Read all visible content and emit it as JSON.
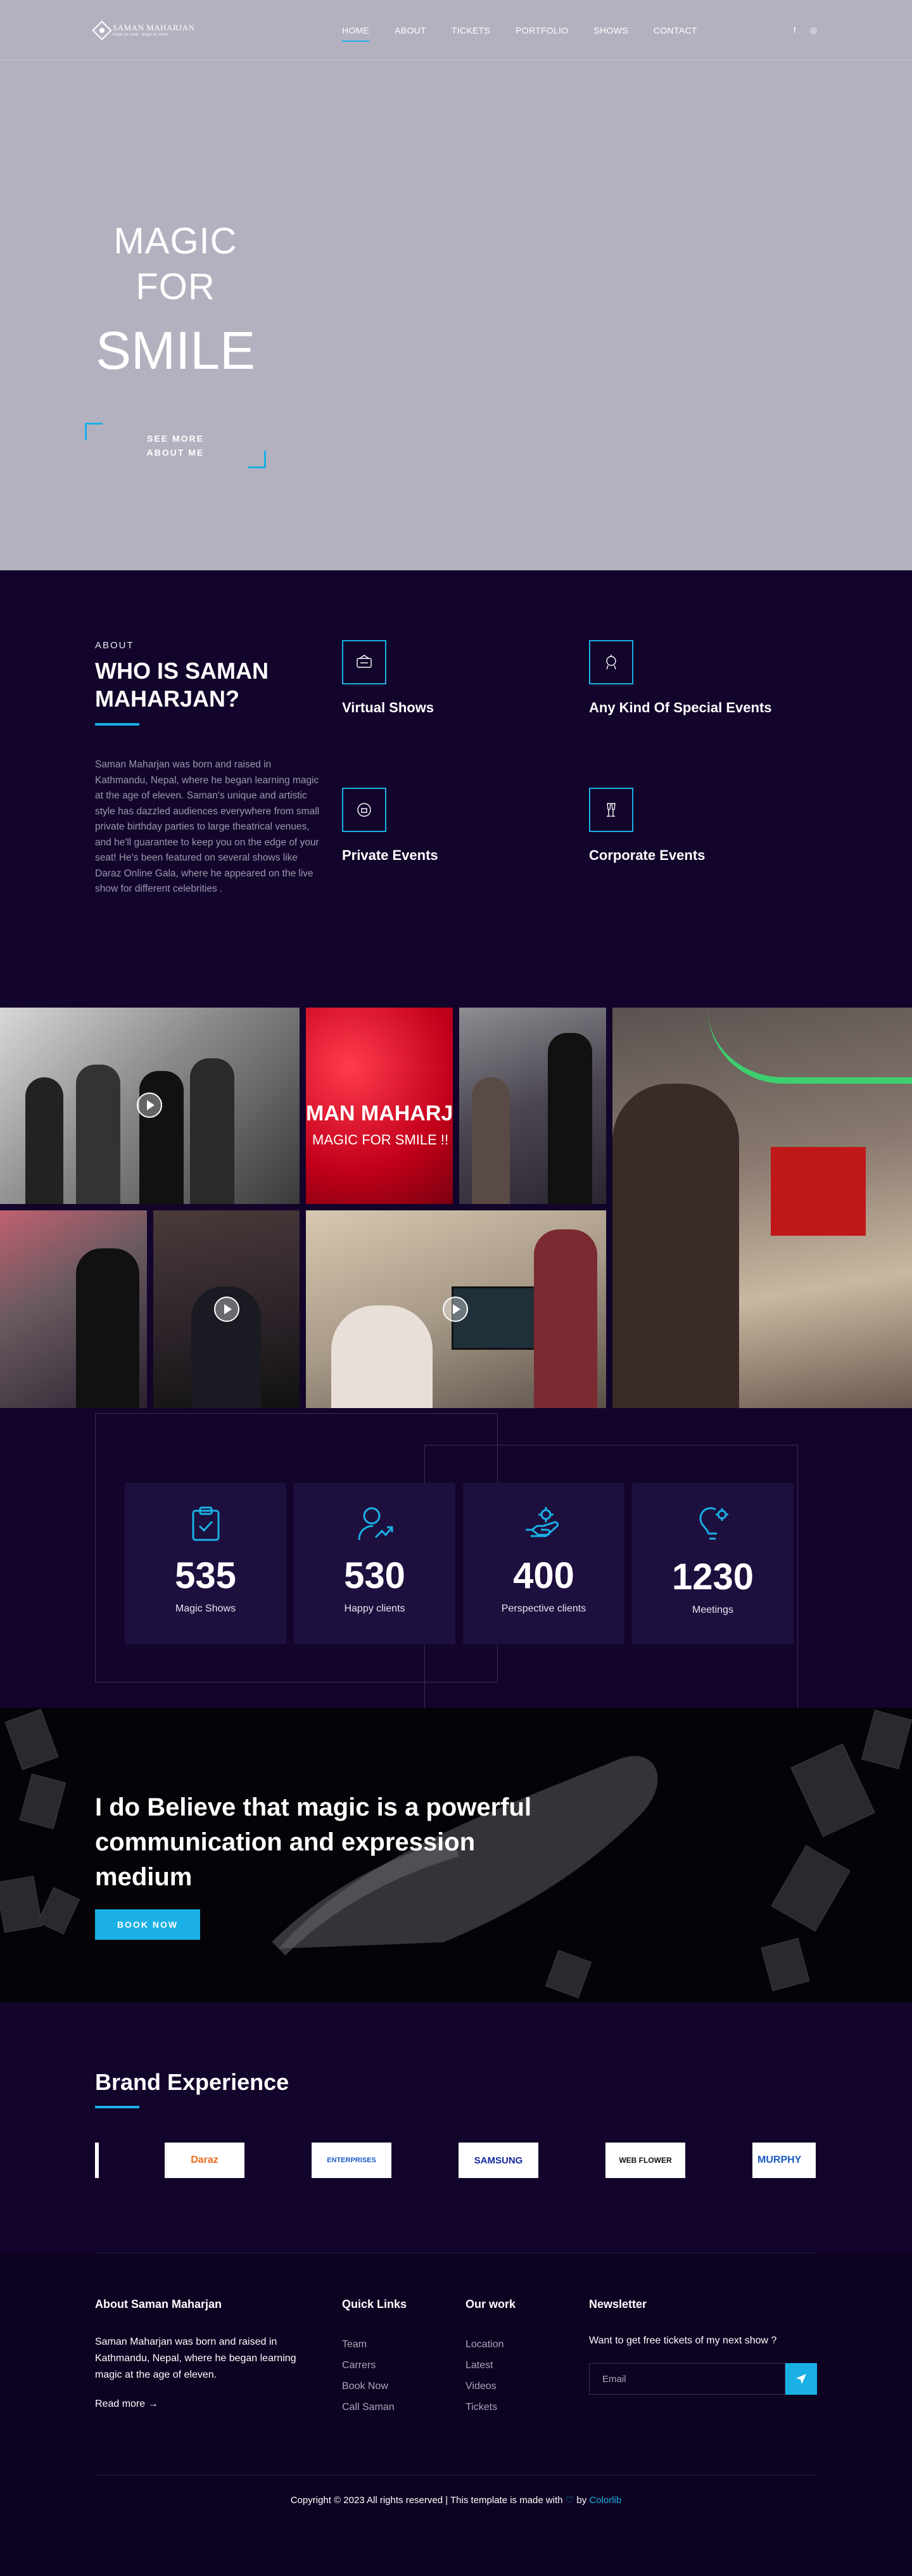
{
  "header": {
    "logo_name": "SAMAN MAHARJAN",
    "logo_tag": "Magic for smile · Magic for Smile",
    "nav": [
      "HOME",
      "ABOUT",
      "TICKETS",
      "PORTFOLIO",
      "SHOWS",
      "CONTACT"
    ],
    "social": [
      "f",
      "◎"
    ]
  },
  "hero": {
    "line1a": "MAGIC",
    "line1b": "FOR",
    "line2": "SMILE",
    "cta_line1": "SEE MORE",
    "cta_line2": "ABOUT ME"
  },
  "about": {
    "eyebrow": "ABOUT",
    "title": "WHO IS SAMAN MAHARJAN?",
    "text": "Saman Maharjan was born and raised in Kathmandu, Nepal, where he began learning magic at the age of eleven. Saman's unique and artistic style has dazzled audiences everywhere from small private birthday parties to large theatrical venues, and he'll guarantee to keep you on the edge of your seat! He's been featured on several shows like Daraz Online Gala, where he appeared on the live show for different celebrities .",
    "services": [
      {
        "title": "Virtual Shows",
        "icon": "virtual-show-icon"
      },
      {
        "title": "Any Kind Of Special Events",
        "icon": "special-event-icon"
      },
      {
        "title": "Private Events",
        "icon": "private-event-icon"
      },
      {
        "title": "Corporate Events",
        "icon": "corporate-event-icon"
      }
    ]
  },
  "gallery": {
    "red_text1": "MAN MAHARJ",
    "red_text2": "MAGIC FOR SMILE !!"
  },
  "stats": [
    {
      "value": "535",
      "label": "Magic Shows"
    },
    {
      "value": "530",
      "label": "Happy clients"
    },
    {
      "value": "400",
      "label": "Perspective clients"
    },
    {
      "value": "1230",
      "label": "Meetings"
    }
  ],
  "quote": {
    "text": "I do Believe that magic is a powerful communication and expression medium",
    "button": "BOOK NOW"
  },
  "brands": {
    "title": "Brand Experience",
    "logos": [
      "Daraz",
      "ENTERPRISES",
      "SAMSUNG",
      "WEB FLOWER",
      "MURPHY"
    ]
  },
  "footer": {
    "about_title": "About Saman Maharjan",
    "about_text": "Saman Maharjan was born and raised in Kathmandu, Nepal, where he began learning magic at the age of eleven.",
    "read_more": "Read more  →",
    "quick_title": "Quick Links",
    "quick_links": [
      "Team",
      "Carrers",
      "Book Now",
      "Call Saman"
    ],
    "work_title": "Our work",
    "work_links": [
      "Location",
      "Latest",
      "Videos",
      "Tickets"
    ],
    "news_title": "Newsletter",
    "news_text": "Want to get free tickets of my next show ?",
    "email_placeholder": "Email",
    "copyright_main": "Copyright © 2023 All rights reserved | This template is made with",
    "copyright_by": "by",
    "copyright_link": "Colorlib"
  },
  "colors": {
    "accent": "#1ab0e6",
    "dark_bg": "#12042a",
    "hero_bg": "#b3b1bf"
  }
}
